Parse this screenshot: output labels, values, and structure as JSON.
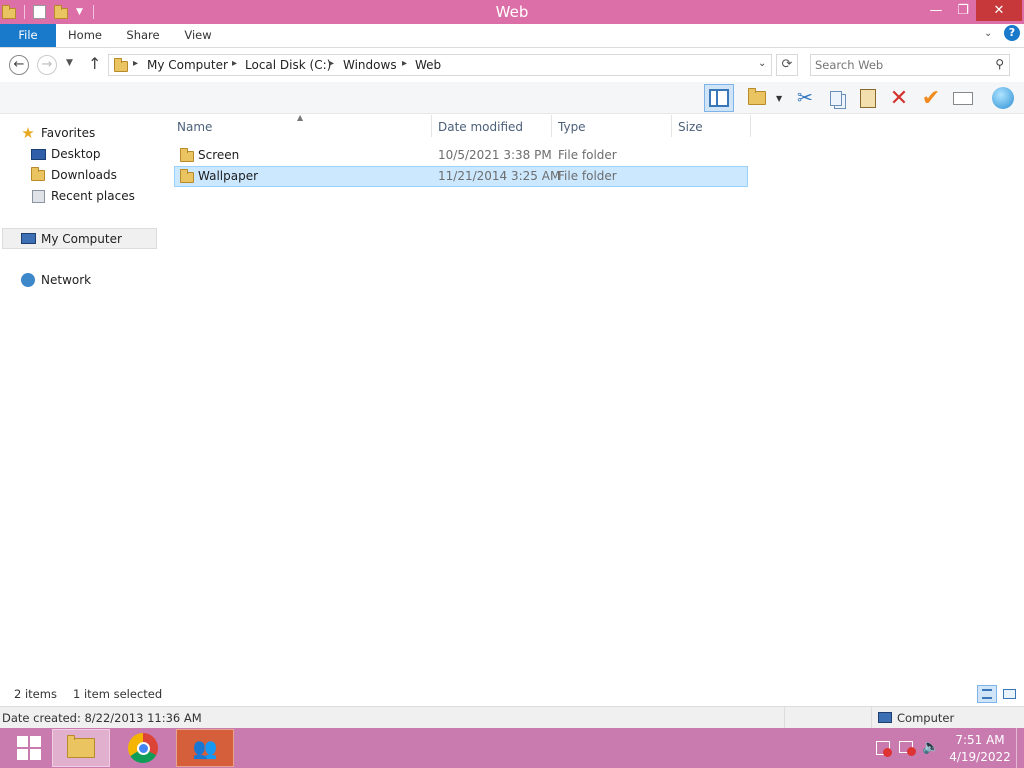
{
  "window": {
    "title": "Web"
  },
  "ribbon": {
    "tabs": [
      "File",
      "Home",
      "Share",
      "View"
    ]
  },
  "address": {
    "crumbs": [
      "My Computer",
      "Local Disk (C:)",
      "Windows",
      "Web"
    ]
  },
  "search": {
    "placeholder": "Search Web"
  },
  "nav": {
    "favorites": "Favorites",
    "desktop": "Desktop",
    "downloads": "Downloads",
    "recent": "Recent places",
    "computer": "My Computer",
    "network": "Network"
  },
  "columns": [
    "Name",
    "Date modified",
    "Type",
    "Size"
  ],
  "files": [
    {
      "name": "Screen",
      "date": "10/5/2021 3:38 PM",
      "type": "File folder",
      "size": ""
    },
    {
      "name": "Wallpaper",
      "date": "11/21/2014 3:25 AM",
      "type": "File folder",
      "size": ""
    }
  ],
  "status": {
    "count": "2 items",
    "selected": "1 item selected",
    "details": "Date created: 8/22/2013 11:36 AM",
    "location": "Computer"
  },
  "clock": {
    "time": "7:51 AM",
    "date": "4/19/2022"
  },
  "colors": {
    "titlebar": "#dd6fa8",
    "file_tab": "#1979ca",
    "selection": "#cce8ff",
    "taskbar": "#c97bb0"
  }
}
